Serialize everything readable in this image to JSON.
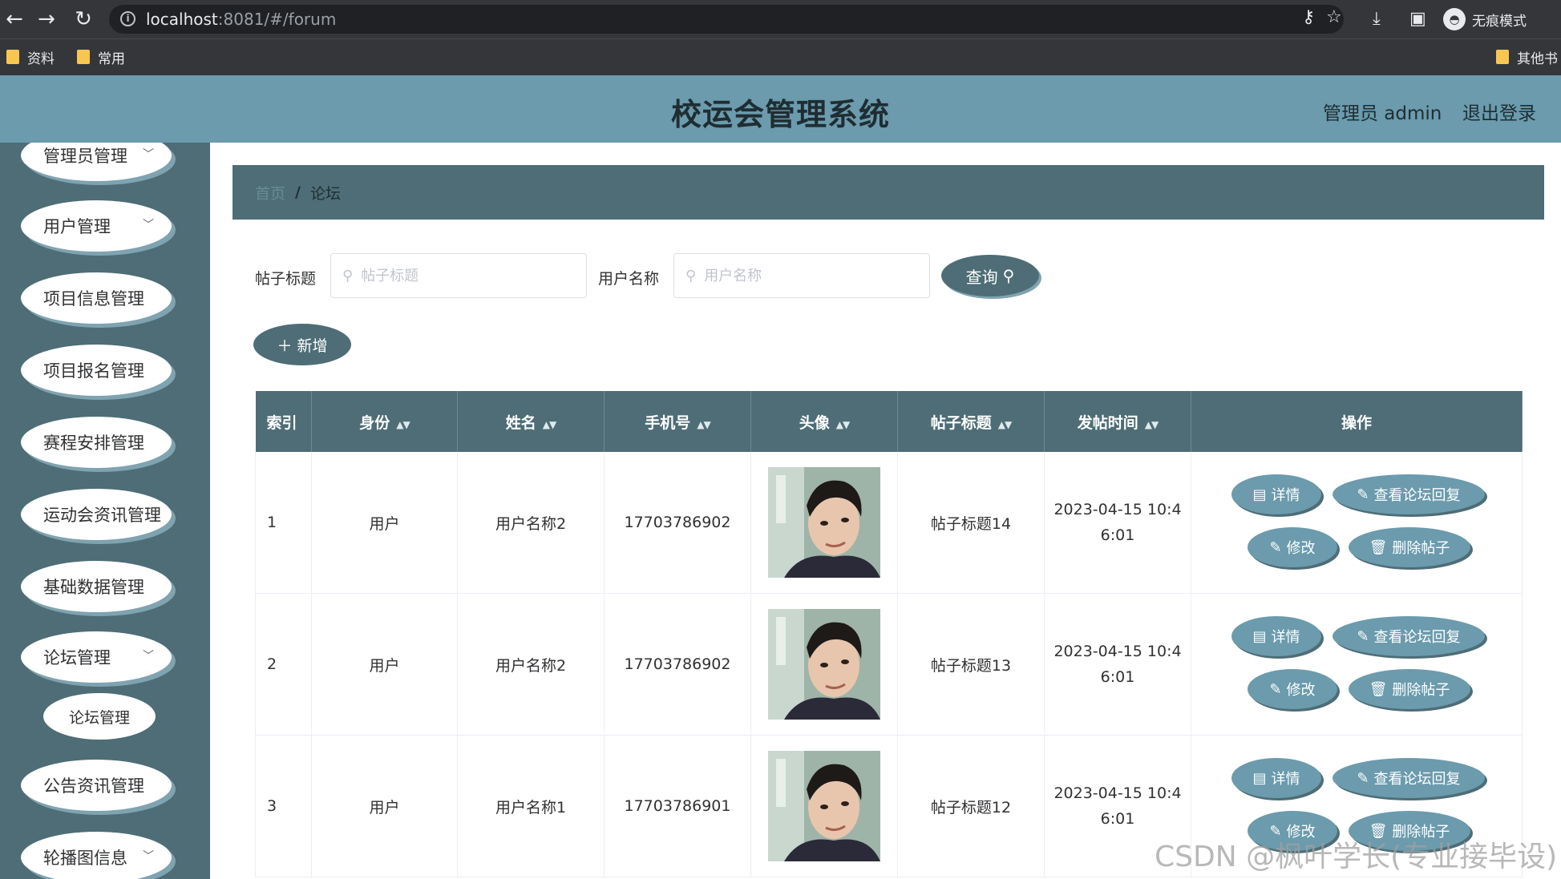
{
  "browser": {
    "url_host": "localhost",
    "url_path": ":8081/#/forum",
    "incognito_label": "无痕模式",
    "bookmarks": [
      "资料",
      "常用"
    ],
    "other_bookmarks": "其他书"
  },
  "header": {
    "title": "校运会管理系统",
    "user": "管理员 admin",
    "logout": "退出登录"
  },
  "sidebar": {
    "items": [
      {
        "label": "管理员管理",
        "has_arrow": true
      },
      {
        "label": "用户管理",
        "has_arrow": true
      },
      {
        "label": "项目信息管理",
        "has_arrow": false
      },
      {
        "label": "项目报名管理",
        "has_arrow": false
      },
      {
        "label": "赛程安排管理",
        "has_arrow": false
      },
      {
        "label": "运动会资讯管理",
        "has_arrow": false
      },
      {
        "label": "基础数据管理",
        "has_arrow": false
      },
      {
        "label": "论坛管理",
        "has_arrow": true
      },
      {
        "label": "公告资讯管理",
        "has_arrow": false
      },
      {
        "label": "轮播图信息",
        "has_arrow": true
      }
    ],
    "subitem": "论坛管理"
  },
  "breadcrumb": {
    "home": "首页",
    "separator": "/",
    "current": "论坛"
  },
  "search": {
    "title_label": "帖子标题",
    "title_placeholder": "帖子标题",
    "user_label": "用户名称",
    "user_placeholder": "用户名称",
    "query_button": "查询"
  },
  "add_button": "新增",
  "table": {
    "columns": [
      "索引",
      "身份",
      "姓名",
      "手机号",
      "头像",
      "帖子标题",
      "发帖时间",
      "操作"
    ],
    "rows": [
      {
        "index": "1",
        "identity": "用户",
        "name": "用户名称2",
        "phone": "17703786902",
        "title": "帖子标题14",
        "time": "2023-04-15 10:46:01"
      },
      {
        "index": "2",
        "identity": "用户",
        "name": "用户名称2",
        "phone": "17703786902",
        "title": "帖子标题13",
        "time": "2023-04-15 10:46:01"
      },
      {
        "index": "3",
        "identity": "用户",
        "name": "用户名称1",
        "phone": "17703786901",
        "title": "帖子标题12",
        "time": "2023-04-15 10:46:01"
      }
    ],
    "actions": {
      "detail": "详情",
      "view_replies": "查看论坛回复",
      "edit": "修改",
      "delete": "删除帖子"
    }
  },
  "watermark": "CSDN @枫叶学长(专业接毕设)",
  "colors": {
    "header_bg": "#6b9bad",
    "sidebar_bg": "#4e6d76",
    "button_dark": "#4e6d76",
    "button_light": "#6b9bad"
  }
}
